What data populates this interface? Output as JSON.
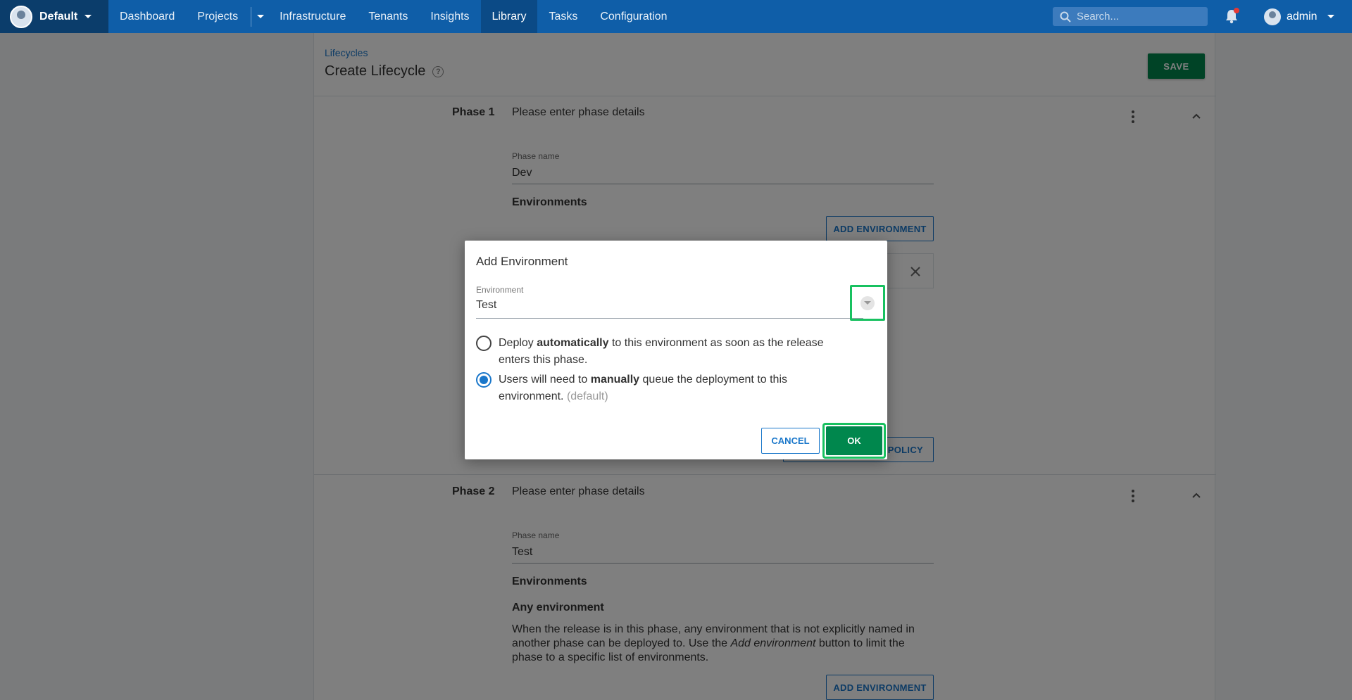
{
  "nav": {
    "space": "Default",
    "items": [
      "Dashboard",
      "Projects",
      "Infrastructure",
      "Tenants",
      "Insights",
      "Library",
      "Tasks",
      "Configuration"
    ],
    "active": "Library",
    "search_placeholder": "Search...",
    "user": "admin"
  },
  "page": {
    "breadcrumb": "Lifecycles",
    "title": "Create Lifecycle",
    "save_label": "SAVE"
  },
  "phase1": {
    "label": "Phase 1",
    "desc": "Please enter phase details",
    "name_label": "Phase name",
    "name_value": "Dev",
    "environments_title": "Environments",
    "add_env_label": "ADD ENVIRONMENT",
    "policy_label": "POLICY"
  },
  "phase2": {
    "label": "Phase 2",
    "desc": "Please enter phase details",
    "name_label": "Phase name",
    "name_value": "Test",
    "environments_title": "Environments",
    "any_env_title": "Any environment",
    "any_env_text_1": "When the release is in this phase, any environment that is not explicitly named in another phase can be deployed to. Use the ",
    "any_env_text_em": "Add environment",
    "any_env_text_2": " button to limit the phase to a specific list of environments.",
    "add_env_label": "ADD ENVIRONMENT"
  },
  "dialog": {
    "title": "Add Environment",
    "env_label": "Environment",
    "env_value": "Test",
    "option_auto_pre": "Deploy ",
    "option_auto_bold": "automatically",
    "option_auto_post": " to this environment as soon as the release enters this phase.",
    "option_manual_pre": "Users will need to ",
    "option_manual_bold": "manually",
    "option_manual_post": " queue the deployment to this environment.",
    "option_manual_default": "(default)",
    "cancel_label": "CANCEL",
    "ok_label": "OK"
  },
  "colors": {
    "nav_bg": "#0f5ea8",
    "primary": "#1a77ca",
    "success": "#00874d",
    "highlight": "#18c160"
  }
}
